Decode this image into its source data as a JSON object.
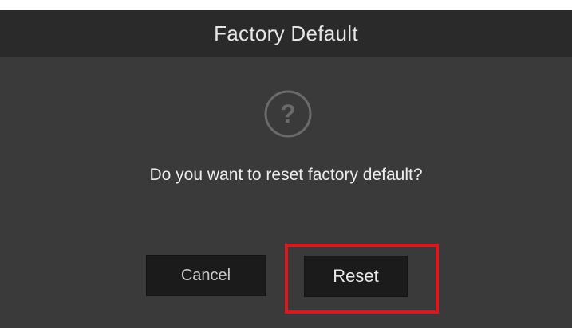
{
  "dialog": {
    "title": "Factory Default",
    "icon": "question-icon",
    "message": "Do you want to reset factory default?",
    "cancel_label": "Cancel",
    "reset_label": "Reset"
  },
  "colors": {
    "dialog_bg": "#3a3a3a",
    "title_bar_bg": "#2a2a2a",
    "button_bg": "#1b1b1b",
    "highlight": "#d81920"
  }
}
